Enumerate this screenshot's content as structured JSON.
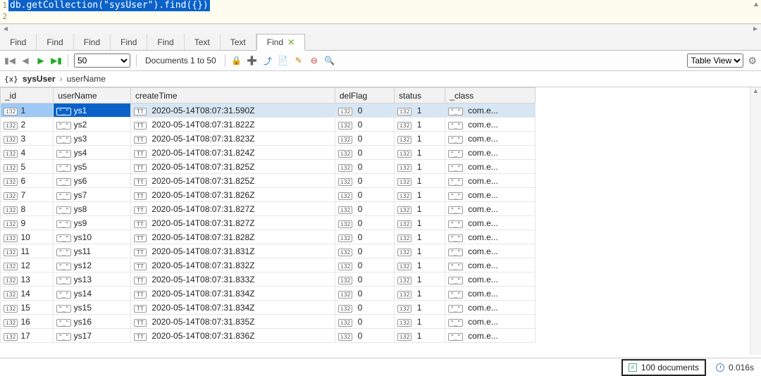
{
  "editor": {
    "line1": "db.getCollection(\"sysUser\").find({})",
    "line2": ""
  },
  "tabs": [
    "Find",
    "Find",
    "Find",
    "Find",
    "Find",
    "Text",
    "Text",
    "Find"
  ],
  "active_tab_index": 7,
  "toolbar": {
    "page_size": "50",
    "doc_range": "Documents 1 to 50",
    "view_mode": "Table View"
  },
  "breadcrumb": {
    "badge": "{x}",
    "collection": "sysUser",
    "field": "userName"
  },
  "columns": [
    "_id",
    "userName",
    "createTime",
    "delFlag",
    "status",
    "_class"
  ],
  "type_badges": {
    "int": "i32",
    "str": "\"_\"",
    "date": "TT"
  },
  "rows": [
    {
      "_id": "1",
      "userName": "ys1",
      "createTime": "2020-05-14T08:07:31.590Z",
      "delFlag": "0",
      "status": "1",
      "_class": "com.e..."
    },
    {
      "_id": "2",
      "userName": "ys2",
      "createTime": "2020-05-14T08:07:31.822Z",
      "delFlag": "0",
      "status": "1",
      "_class": "com.e..."
    },
    {
      "_id": "3",
      "userName": "ys3",
      "createTime": "2020-05-14T08:07:31.823Z",
      "delFlag": "0",
      "status": "1",
      "_class": "com.e..."
    },
    {
      "_id": "4",
      "userName": "ys4",
      "createTime": "2020-05-14T08:07:31.824Z",
      "delFlag": "0",
      "status": "1",
      "_class": "com.e..."
    },
    {
      "_id": "5",
      "userName": "ys5",
      "createTime": "2020-05-14T08:07:31.825Z",
      "delFlag": "0",
      "status": "1",
      "_class": "com.e..."
    },
    {
      "_id": "6",
      "userName": "ys6",
      "createTime": "2020-05-14T08:07:31.825Z",
      "delFlag": "0",
      "status": "1",
      "_class": "com.e..."
    },
    {
      "_id": "7",
      "userName": "ys7",
      "createTime": "2020-05-14T08:07:31.826Z",
      "delFlag": "0",
      "status": "1",
      "_class": "com.e..."
    },
    {
      "_id": "8",
      "userName": "ys8",
      "createTime": "2020-05-14T08:07:31.827Z",
      "delFlag": "0",
      "status": "1",
      "_class": "com.e..."
    },
    {
      "_id": "9",
      "userName": "ys9",
      "createTime": "2020-05-14T08:07:31.827Z",
      "delFlag": "0",
      "status": "1",
      "_class": "com.e..."
    },
    {
      "_id": "10",
      "userName": "ys10",
      "createTime": "2020-05-14T08:07:31.828Z",
      "delFlag": "0",
      "status": "1",
      "_class": "com.e..."
    },
    {
      "_id": "11",
      "userName": "ys11",
      "createTime": "2020-05-14T08:07:31.831Z",
      "delFlag": "0",
      "status": "1",
      "_class": "com.e..."
    },
    {
      "_id": "12",
      "userName": "ys12",
      "createTime": "2020-05-14T08:07:31.832Z",
      "delFlag": "0",
      "status": "1",
      "_class": "com.e..."
    },
    {
      "_id": "13",
      "userName": "ys13",
      "createTime": "2020-05-14T08:07:31.833Z",
      "delFlag": "0",
      "status": "1",
      "_class": "com.e..."
    },
    {
      "_id": "14",
      "userName": "ys14",
      "createTime": "2020-05-14T08:07:31.834Z",
      "delFlag": "0",
      "status": "1",
      "_class": "com.e..."
    },
    {
      "_id": "15",
      "userName": "ys15",
      "createTime": "2020-05-14T08:07:31.834Z",
      "delFlag": "0",
      "status": "1",
      "_class": "com.e..."
    },
    {
      "_id": "16",
      "userName": "ys16",
      "createTime": "2020-05-14T08:07:31.835Z",
      "delFlag": "0",
      "status": "1",
      "_class": "com.e..."
    },
    {
      "_id": "17",
      "userName": "ys17",
      "createTime": "2020-05-14T08:07:31.836Z",
      "delFlag": "0",
      "status": "1",
      "_class": "com.e..."
    }
  ],
  "status": {
    "doc_count": "100 documents",
    "timing": "0.016s"
  }
}
